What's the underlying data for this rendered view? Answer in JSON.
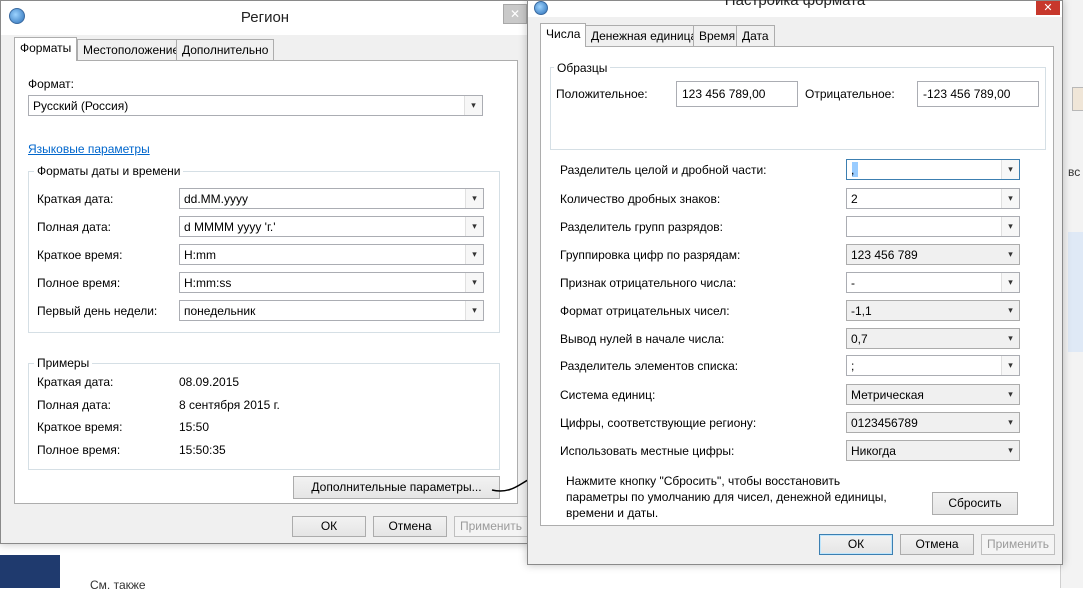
{
  "background": {
    "see_also_text": "См. также"
  },
  "region": {
    "title": "Регион",
    "tabs": [
      "Форматы",
      "Местоположение",
      "Дополнительно"
    ],
    "format_label": "Формат:",
    "format_value": "Русский (Россия)",
    "language_link": "Языковые параметры",
    "datetime_group_title": "Форматы даты и времени",
    "datetime_rows": [
      {
        "label": "Краткая дата:",
        "value": "dd.MM.yyyy"
      },
      {
        "label": "Полная дата:",
        "value": "d MMMM yyyy 'г.'"
      },
      {
        "label": "Краткое время:",
        "value": "H:mm"
      },
      {
        "label": "Полное время:",
        "value": "H:mm:ss"
      },
      {
        "label": "Первый день недели:",
        "value": "понедельник"
      }
    ],
    "examples_group_title": "Примеры",
    "examples": [
      {
        "label": "Краткая дата:",
        "value": "08.09.2015"
      },
      {
        "label": "Полная дата:",
        "value": "8 сентября 2015 г."
      },
      {
        "label": "Краткое время:",
        "value": "15:50"
      },
      {
        "label": "Полное время:",
        "value": "15:50:35"
      }
    ],
    "additional_button": "Дополнительные параметры...",
    "ok": "ОК",
    "cancel": "Отмена",
    "apply": "Применить"
  },
  "format_settings": {
    "title": "Настройка формата",
    "tabs": [
      "Числа",
      "Денежная единица",
      "Время",
      "Дата"
    ],
    "samples_title": "Образцы",
    "positive_label": "Положительное:",
    "positive_value": "123 456 789,00",
    "negative_label": "Отрицательное:",
    "negative_value": "-123 456 789,00",
    "rows": [
      {
        "label": "Разделитель целой и дробной части:",
        "value": ","
      },
      {
        "label": "Количество дробных знаков:",
        "value": "2"
      },
      {
        "label": "Разделитель групп разрядов:",
        "value": ""
      },
      {
        "label": "Группировка цифр по разрядам:",
        "value": "123 456 789"
      },
      {
        "label": "Признак отрицательного числа:",
        "value": "-"
      },
      {
        "label": "Формат отрицательных чисел:",
        "value": "-1,1"
      },
      {
        "label": "Вывод нулей в начале числа:",
        "value": "0,7"
      },
      {
        "label": "Разделитель элементов списка:",
        "value": ";"
      },
      {
        "label": "Система единиц:",
        "value": "Метрическая"
      },
      {
        "label": "Цифры, соответствующие региону:",
        "value": "0123456789"
      },
      {
        "label": "Использовать местные цифры:",
        "value": "Никогда"
      }
    ],
    "reset_note_lines": [
      "Нажмите кнопку \"Сбросить\", чтобы восстановить",
      "параметры по умолчанию для чисел, денежной единицы,",
      "времени и даты."
    ],
    "reset_button": "Сбросить",
    "ok": "ОК",
    "cancel": "Отмена",
    "apply": "Применить"
  },
  "icons": {
    "dropdown": "▾",
    "close": "✕"
  }
}
